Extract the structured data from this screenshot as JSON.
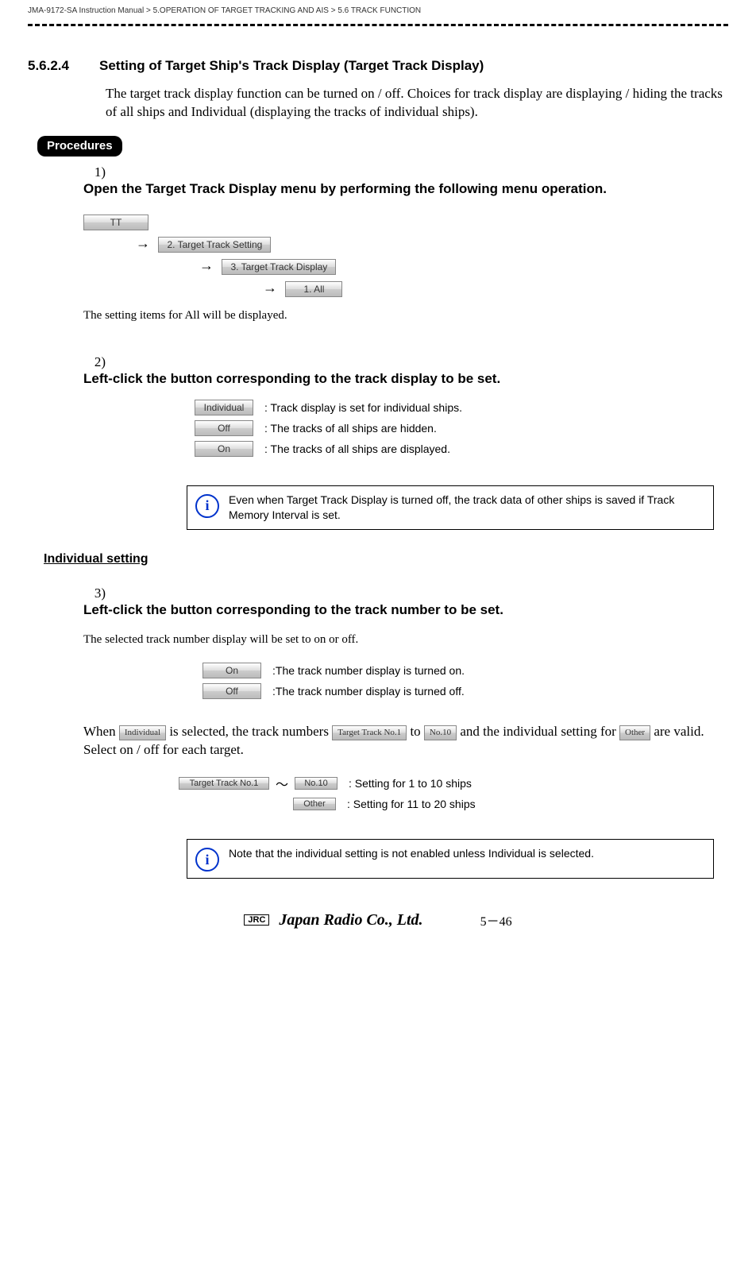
{
  "header": {
    "breadcrumb": "JMA-9172-SA Instruction Manual > 5.OPERATION OF TARGET TRACKING AND AIS > 5.6  TRACK FUNCTION"
  },
  "section": {
    "number": "5.6.2.4",
    "title": "Setting of Target Ship's Track Display (Target Track Display)",
    "intro": "The target track display function can be turned on / off. Choices for track display are displaying / hiding the tracks of all ships and Individual (displaying the tracks of individual ships)."
  },
  "procedures_label": "Procedures",
  "step1": {
    "num": "1)",
    "title": "Open the Target Track Display menu by performing the following menu operation.",
    "menu": {
      "b1": "TT",
      "b2": "2. Target Track Setting",
      "b3": "3. Target Track Display",
      "b4": "1. All"
    },
    "note": "The setting items for All will be displayed."
  },
  "step2": {
    "num": "2)",
    "title": "Left-click the button corresponding to the track display to be set.",
    "options": [
      {
        "btn": "Individual",
        "desc": ": Track display is set for individual ships."
      },
      {
        "btn": "Off",
        "desc": ": The tracks of all ships are hidden."
      },
      {
        "btn": "On",
        "desc": ": The tracks of all ships are displayed."
      }
    ],
    "info": "Even when Target Track Display is turned off, the track data of other ships is saved if Track Memory Interval is set."
  },
  "individual_heading": "Individual setting",
  "step3": {
    "num": "3)",
    "title": "Left-click the button corresponding to the track number to be set.",
    "note": "The selected track number display will be set to on or off.",
    "options": [
      {
        "btn": "On",
        "desc": ":The track number display is turned on."
      },
      {
        "btn": "Off",
        "desc": ":The track number display is turned off."
      }
    ],
    "when_pre": "When ",
    "when_btn1": "Individual",
    "when_mid1": " is selected, the track numbers ",
    "when_btn2": "Target Track No.1",
    "when_mid2": " to ",
    "when_btn3": "No.10",
    "when_mid3": " and the individual setting for ",
    "when_btn4": "Other",
    "when_end": " are valid. Select on / off for each target.",
    "range1": {
      "b1": "Target Track No.1",
      "tilde": "～",
      "b2": "No.10",
      "desc": ": Setting for 1 to 10 ships"
    },
    "range2": {
      "b": "Other",
      "desc": ": Setting for 11 to 20 ships"
    },
    "info": "Note that the individual setting is not enabled unless  Individual is selected."
  },
  "footer": {
    "jrc": "JRC",
    "company": "Japan Radio Co., Ltd.",
    "page": "5－46"
  }
}
